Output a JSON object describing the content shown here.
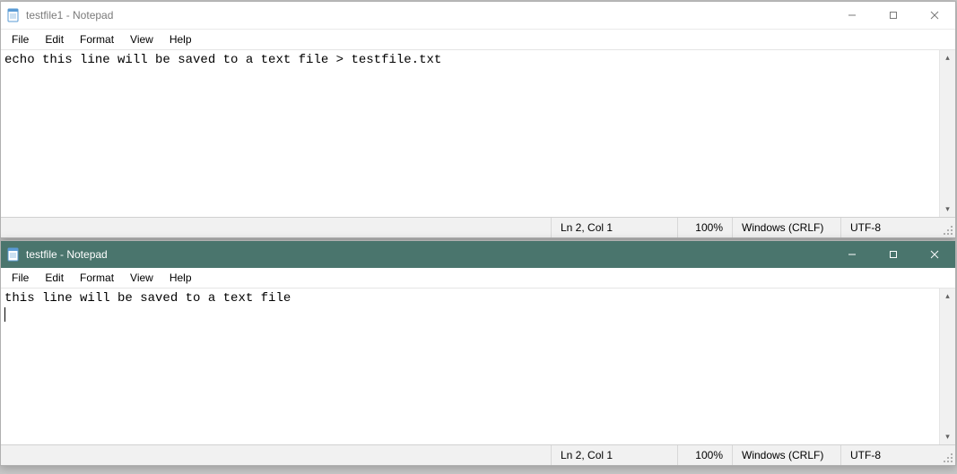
{
  "windows": [
    {
      "id": "win1",
      "title": "testfile1 - Notepad",
      "active": false,
      "menu": [
        "File",
        "Edit",
        "Format",
        "View",
        "Help"
      ],
      "content": "echo this line will be saved to a text file > testfile.txt",
      "status": {
        "position": "Ln 2, Col 1",
        "zoom": "100%",
        "line_ending": "Windows (CRLF)",
        "encoding": "UTF-8"
      }
    },
    {
      "id": "win2",
      "title": "testfile - Notepad",
      "active": true,
      "menu": [
        "File",
        "Edit",
        "Format",
        "View",
        "Help"
      ],
      "content": "this line will be saved to a text file",
      "status": {
        "position": "Ln 2, Col 1",
        "zoom": "100%",
        "line_ending": "Windows (CRLF)",
        "encoding": "UTF-8"
      }
    }
  ]
}
